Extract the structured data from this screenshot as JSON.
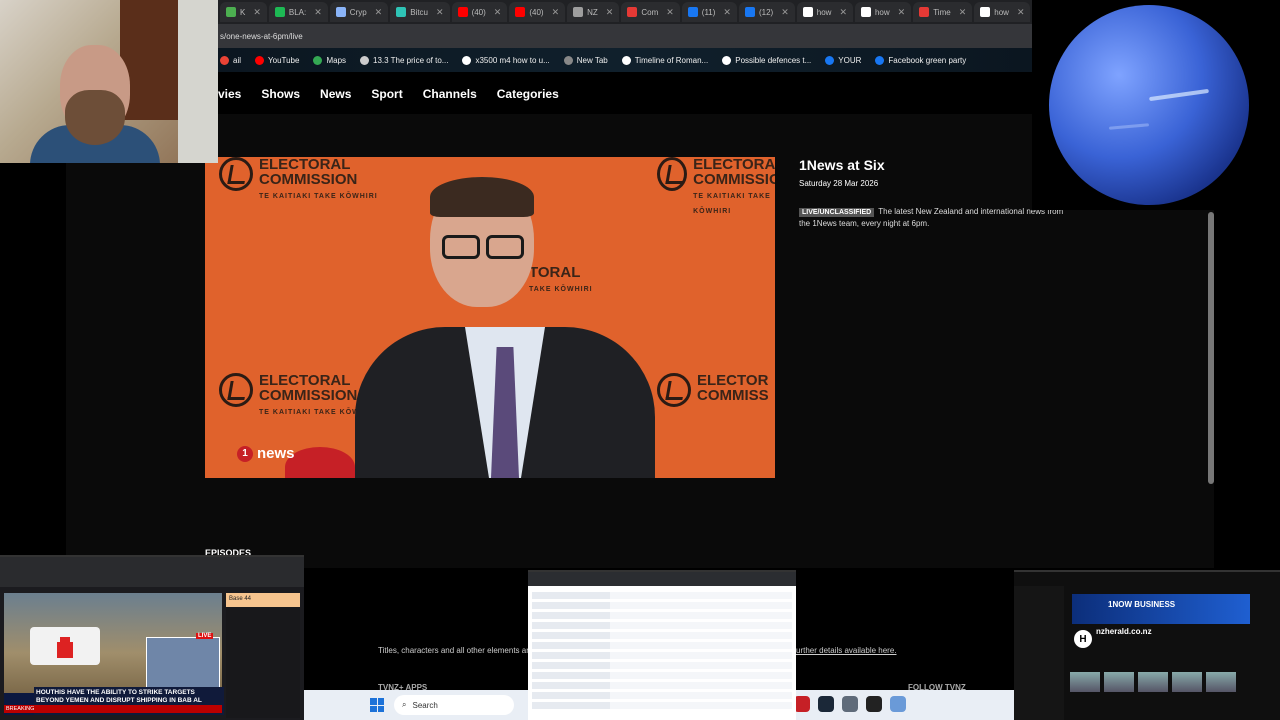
{
  "tabs": [
    {
      "label": "K",
      "color": "#4caf50"
    },
    {
      "label": "BLA:",
      "color": "#1db954"
    },
    {
      "label": "Cryp",
      "color": "#8ab4f8"
    },
    {
      "label": "Bitcu",
      "color": "#2ec4b6"
    },
    {
      "label": "(40)",
      "color": "#ff0000"
    },
    {
      "label": "(40)",
      "color": "#ff0000"
    },
    {
      "label": "NZ",
      "color": "#9e9e9e"
    },
    {
      "label": "Com",
      "color": "#e53935"
    },
    {
      "label": "(11)",
      "color": "#1877f2"
    },
    {
      "label": "(12)",
      "color": "#1877f2"
    },
    {
      "label": "how",
      "color": "#ffffff"
    },
    {
      "label": "how",
      "color": "#ffffff"
    },
    {
      "label": "Time",
      "color": "#e53935"
    },
    {
      "label": "how",
      "color": "#ffffff"
    }
  ],
  "address": {
    "url": "s/one-news-at-6pm/live"
  },
  "bookmarks": [
    {
      "label": "ail",
      "color": "#ea4335"
    },
    {
      "label": "YouTube",
      "color": "#ff0000"
    },
    {
      "label": "Maps",
      "color": "#34a853"
    },
    {
      "label": "13.3 The price of to...",
      "color": "#cccccc"
    },
    {
      "label": "x3500 m4 how to u...",
      "color": "#ffffff"
    },
    {
      "label": "New Tab",
      "color": "#888888"
    },
    {
      "label": "Timeline of Roman...",
      "color": "#ffffff"
    },
    {
      "label": "Possible defences t...",
      "color": "#ffffff"
    },
    {
      "label": "YOUR",
      "color": "#1877f2"
    },
    {
      "label": "Facebook green party",
      "color": "#1877f2"
    }
  ],
  "site_nav": [
    "vies",
    "Shows",
    "News",
    "Sport",
    "Channels",
    "Categories"
  ],
  "video": {
    "ec_title_1": "ELECTORAL",
    "ec_title_2": "COMMISSION",
    "ec_sub": "TE KAITIAKI TAKE KŌWHIRI",
    "ec_partial": "TORAL",
    "ec_partial_sub": "TAKE KŌWHIRI",
    "ec_right_1": "ELECTOR",
    "ec_right_2": "COMMISS",
    "bug": "news",
    "bug_num": "1"
  },
  "program": {
    "title": "1News at Six",
    "date": "Saturday 28 Mar 2026",
    "badge": "LIVE/UNCLASSIFIED",
    "description": "The latest New Zealand and international news from the 1News team, every night at 6pm."
  },
  "episodes_label": "EPISODES",
  "footer": {
    "note": "Titles, characters and all other elements are",
    "link": "urther details available here.",
    "apps": "TVNZ+ APPS",
    "follow": "FOLLOW TVNZ"
  },
  "taskbar": {
    "search_placeholder": "Search"
  },
  "thumb_left": {
    "live": "LIVE",
    "headline": "HOUTHIS HAVE THE ABILITY TO STRIKE TARGETS BEYOND YEMEN AND DISRUPT SHIPPING IN BAB AL MANDAB STRAIT",
    "breaking": "BREAKING",
    "chat_header": "Base 44"
  },
  "thumb_right": {
    "banner": "1NOW BUSINESS",
    "site_name": "nzherald.co.nz"
  }
}
